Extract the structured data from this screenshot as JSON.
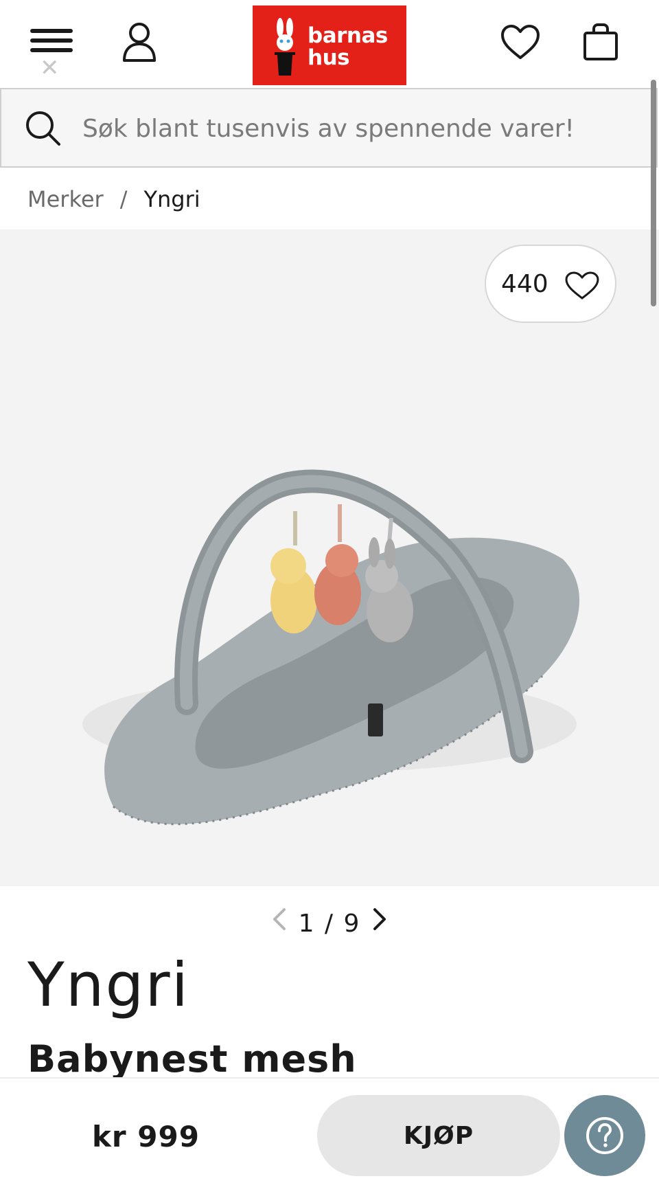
{
  "header": {
    "logo_text_line1": "barnas",
    "logo_text_line2": "hus"
  },
  "search": {
    "placeholder": "Søk blant tusenvis av spennende varer!"
  },
  "breadcrumb": {
    "items": [
      "Merker",
      "Yngri"
    ],
    "separator": "/"
  },
  "gallery": {
    "like_count": "440",
    "pager_label": "1 / 9"
  },
  "product": {
    "brand_logo_text": "Yngri",
    "title": "Babynest mesh",
    "price": "kr 999",
    "buy_label": "KJØP"
  },
  "colors": {
    "brand_red": "#e32119",
    "help_button": "#6f8b97",
    "gallery_bg": "#f3f3f3"
  },
  "icons": [
    "menu-icon",
    "close-icon",
    "user-icon",
    "heart-icon",
    "shopping-bag-icon",
    "search-icon",
    "chevron-left-icon",
    "chevron-right-icon",
    "help-icon"
  ]
}
